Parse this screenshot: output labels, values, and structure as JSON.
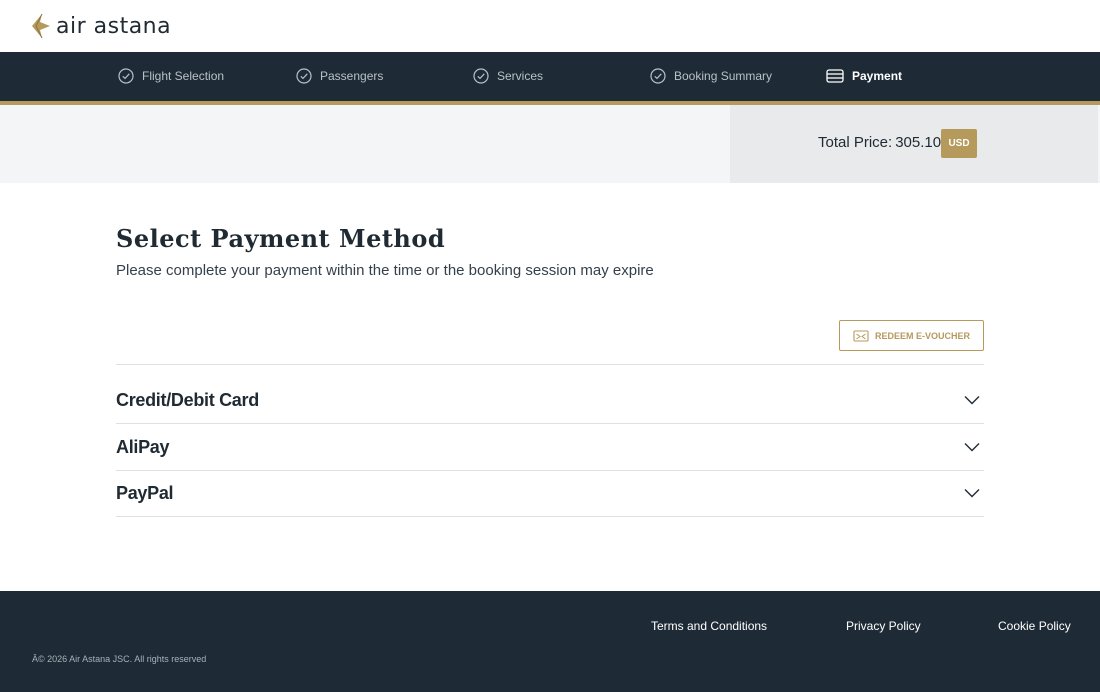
{
  "header": {
    "logo_text": "air astana",
    "logo_icon": "air-astana-wing-logo",
    "brand_color": "#b59a5c"
  },
  "steps": [
    {
      "label": "Flight Selection",
      "icon": "check-circle-icon",
      "state": "done"
    },
    {
      "label": "Passengers",
      "icon": "check-circle-icon",
      "state": "done"
    },
    {
      "label": "Services",
      "icon": "check-circle-icon",
      "state": "done"
    },
    {
      "label": "Booking Summary",
      "icon": "check-circle-icon",
      "state": "done"
    },
    {
      "label": "Payment",
      "icon": "wallet-icon",
      "state": "active"
    }
  ],
  "price": {
    "label": "Total Price:",
    "value": "305.10",
    "currency": "USD"
  },
  "main": {
    "title": "Select Payment Method",
    "subtitle": "Please complete your payment within the time or the booking session may expire",
    "voucher_label": "REDEEM E-VOUCHER",
    "methods": [
      {
        "label": "Credit/Debit Card"
      },
      {
        "label": "AliPay"
      },
      {
        "label": "PayPal"
      }
    ]
  },
  "footer": {
    "links": [
      "Terms and Conditions",
      "Privacy Policy",
      "Cookie Policy"
    ],
    "copyright": "Â© 2026 Air Astana JSC. All rights reserved"
  },
  "colors": {
    "nav_bg": "#1e2a35",
    "accent": "#b59a5c",
    "text": "#1f2a33"
  }
}
